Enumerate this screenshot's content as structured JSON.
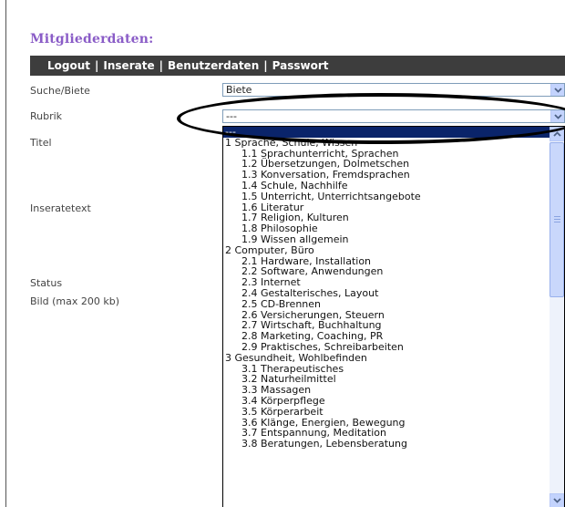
{
  "heading": "Mitgliederdaten:",
  "nav": {
    "logout": "Logout",
    "inserate": "Inserate",
    "benutzerdaten": "Benutzerdaten",
    "passwort": "Passwort",
    "separator": "|"
  },
  "form": {
    "suche_biete_label": "Suche/Biete",
    "suche_biete_value": "Biete",
    "rubrik_label": "Rubrik",
    "rubrik_value": "---",
    "titel_label": "Titel",
    "inseratetext_label": "Inseratetext",
    "status_label": "Status",
    "bild_label": "Bild (max 200 kb)"
  },
  "rubrik_options": [
    {
      "label": "---",
      "level": 1,
      "selected": true
    },
    {
      "label": "1 Sprache, Schule, Wissen",
      "level": 1
    },
    {
      "label": "1.1 Sprachunterricht, Sprachen",
      "level": 2
    },
    {
      "label": "1.2 Übersetzungen, Dolmetschen",
      "level": 2
    },
    {
      "label": "1.3 Konversation, Fremdsprachen",
      "level": 2
    },
    {
      "label": "1.4 Schule, Nachhilfe",
      "level": 2
    },
    {
      "label": "1.5 Unterricht, Unterrichtsangebote",
      "level": 2
    },
    {
      "label": "1.6 Literatur",
      "level": 2
    },
    {
      "label": "1.7 Religion, Kulturen",
      "level": 2
    },
    {
      "label": "1.8 Philosophie",
      "level": 2
    },
    {
      "label": "1.9 Wissen allgemein",
      "level": 2
    },
    {
      "label": "2  Computer, Büro",
      "level": 1
    },
    {
      "label": "2.1 Hardware, Installation",
      "level": 2
    },
    {
      "label": "2.2 Software, Anwendungen",
      "level": 2
    },
    {
      "label": "2.3 Internet",
      "level": 2
    },
    {
      "label": "2.4 Gestalterisches, Layout",
      "level": 2
    },
    {
      "label": "2.5 CD-Brennen",
      "level": 2
    },
    {
      "label": "2.6 Versicherungen, Steuern",
      "level": 2
    },
    {
      "label": "2.7 Wirtschaft, Buchhaltung",
      "level": 2
    },
    {
      "label": "2.8 Marketing, Coaching, PR",
      "level": 2
    },
    {
      "label": "2.9 Praktisches, Schreibarbeiten",
      "level": 2
    },
    {
      "label": "3 Gesundheit, Wohlbefinden",
      "level": 1
    },
    {
      "label": "3.1 Therapeutisches",
      "level": 2
    },
    {
      "label": "3.2 Naturheilmittel",
      "level": 2
    },
    {
      "label": "3.3 Massagen",
      "level": 2
    },
    {
      "label": "3.4 Körperpflege",
      "level": 2
    },
    {
      "label": "3.5 Körperarbeit",
      "level": 2
    },
    {
      "label": "3.6 Klänge, Energien, Bewegung",
      "level": 2
    },
    {
      "label": "3.7 Entspannung, Meditation",
      "level": 2
    },
    {
      "label": "3.8 Beratungen, Lebensberatung",
      "level": 2
    }
  ],
  "icons": {
    "select_arrow": "chevron-down-icon",
    "scroll_up": "chevron-up-icon",
    "scroll_down": "chevron-down-icon"
  },
  "colors": {
    "heading": "#8a5cc7",
    "navbar": "#3d3d3d",
    "selected_option": "#0a246a",
    "arrow_button": "#c3d3fd",
    "annotation_ellipse": "#000000"
  }
}
